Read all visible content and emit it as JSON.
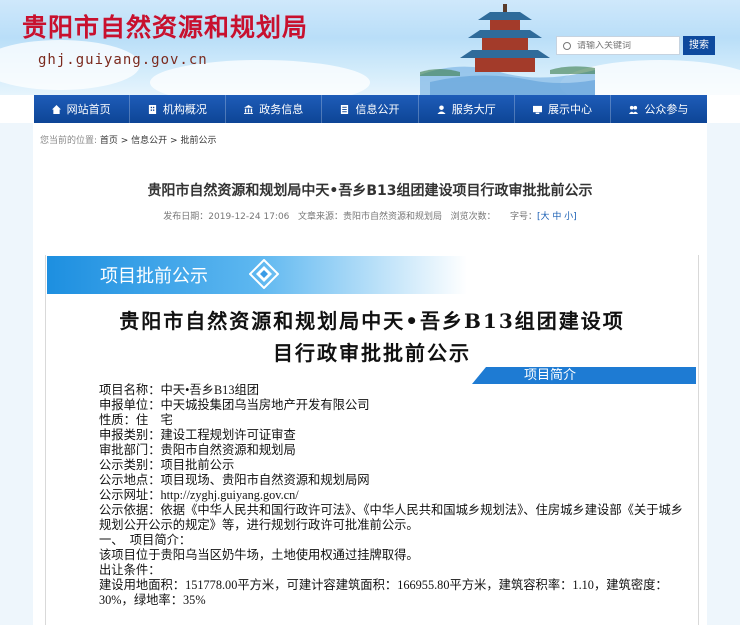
{
  "header": {
    "site_title": "贵阳市自然资源和规划局",
    "site_domain": "ghj.guiyang.gov.cn",
    "search_placeholder": "请输入关键词",
    "search_button": "搜索"
  },
  "nav": [
    {
      "label": "网站首页",
      "icon": "home-icon"
    },
    {
      "label": "机构概况",
      "icon": "building-icon"
    },
    {
      "label": "政务信息",
      "icon": "institution-icon"
    },
    {
      "label": "信息公开",
      "icon": "document-icon"
    },
    {
      "label": "服务大厅",
      "icon": "service-icon"
    },
    {
      "label": "展示中心",
      "icon": "display-icon"
    },
    {
      "label": "公众参与",
      "icon": "people-icon"
    }
  ],
  "breadcrumb": {
    "prefix": "您当前的位置:",
    "path": "首页 > 信息公开 > 批前公示"
  },
  "article": {
    "title": "贵阳市自然资源和规划局中天•吾乡B13组团建设项目行政审批批前公示",
    "meta_published": "发布日期：2019-12-24 17:06",
    "meta_source": "文章来源：贵阳市自然资源和规划局",
    "meta_views": "浏览次数：",
    "meta_fontsize_label": "字号：",
    "meta_fontsize_options": "[大 中 小]"
  },
  "notice": {
    "tab_label": "项目批前公示",
    "big_title_line1": "贵阳市自然资源和规划局中天•吾乡B13组团建设项",
    "big_title_line2": "目行政审批批前公示",
    "intro_label": "项目简介",
    "lines": [
      "项目名称：中天•吾乡B13组团",
      "申报单位：中天城投集团乌当房地产开发有限公司",
      "性质：住　宅",
      "申报类别：建设工程规划许可证审查",
      "审批部门：贵阳市自然资源和规划局",
      "公示类别：项目批前公示",
      "公示地点：项目现场、贵阳市自然资源和规划局网",
      "公示网址：http://zyghj.guiyang.gov.cn/",
      "公示依据：依据《中华人民共和国行政许可法》、《中华人民共和国城乡规划法》、住房城乡建设部《关于城乡规划公开公示的规定》等，进行规划行政许可批准前公示。",
      "一、　项目简介：",
      "该项目位于贵阳乌当区奶牛场，土地使用权通过挂牌取得。",
      "出让条件：",
      "建设用地面积：151778.00平方米，可建计容建筑面积：166955.80平方米，建筑容积率：1.10，建筑密度：30%，绿地率：35%"
    ]
  },
  "colors": {
    "title_red": "#c8102e",
    "nav_blue": "#0d4596",
    "accent_blue": "#1e7bd3"
  }
}
